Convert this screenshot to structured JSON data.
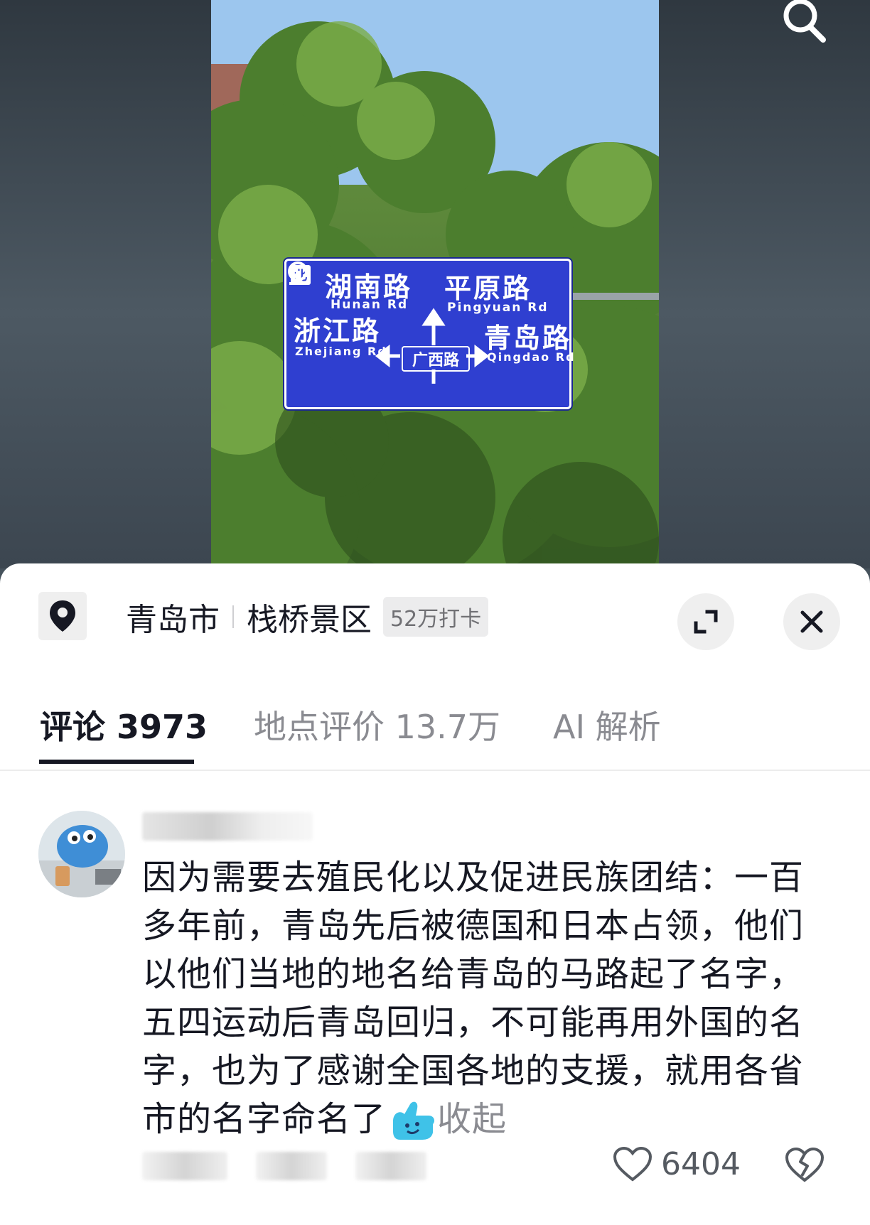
{
  "photo": {
    "sign": {
      "north_label": "北",
      "roads": {
        "top_left_cn": "湖南路",
        "top_left_en": "Hunan Rd",
        "top_right_cn": "平原路",
        "top_right_en": "Pingyuan Rd",
        "left_cn": "浙江路",
        "left_en": "Zhejiang Rd",
        "right_cn": "青岛路",
        "right_en": "Qingdao Rd",
        "center_cn": "广西路"
      }
    }
  },
  "header": {
    "search_icon": "search-icon"
  },
  "location": {
    "icon": "location-pin-icon",
    "city": "青岛市",
    "spot": "栈桥景区",
    "checkins": "52万打卡"
  },
  "actions": {
    "expand_icon": "expand-icon",
    "close_icon": "close-icon"
  },
  "tabs": [
    {
      "label": "评论 3973",
      "active": true
    },
    {
      "label": "地点评价 13.7万",
      "active": false
    },
    {
      "label": "AI 解析",
      "active": false
    }
  ],
  "comment": {
    "text": "因为需要去殖民化以及促进民族团结：一百多年前，青岛先后被德国和日本占领，他们以他们当地的地名给青岛的马路起了名字，五四运动后青岛回归，不可能再用外国的名字，也为了感谢全国各地的支援，就用各省市的名字命名了",
    "collapse_label": "收起",
    "likes": "6404"
  },
  "colors": {
    "accent": "#161823",
    "sign_blue": "#2f3fd0",
    "muted": "#8a8b91"
  }
}
